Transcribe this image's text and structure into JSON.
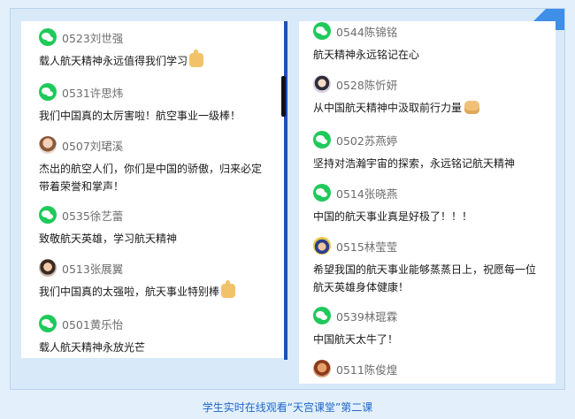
{
  "left_column": [
    {
      "user": "0523刘世强",
      "avatar": "wechat-icon",
      "text": "载人航天精神永远值得我们学习",
      "emoji": "thumbs-up-icon"
    },
    {
      "user": "0531许思炜",
      "avatar": "wechat-icon",
      "text": "我们中国真的太厉害啦！航空事业一级棒！",
      "emoji": ""
    },
    {
      "user": "0507刘珺溪",
      "avatar": "user-photo",
      "text": "杰出的航空人们，你们是中国的骄傲，归来必定带着荣誉和掌声！",
      "emoji": ""
    },
    {
      "user": "0535徐艺蕾",
      "avatar": "wechat-icon",
      "text": "致敬航天英雄，学习航天精神",
      "emoji": ""
    },
    {
      "user": "0513张展翼",
      "avatar": "user-photo",
      "text": "我们中国真的太强啦，航天事业特别棒",
      "emoji": "thumbs-up-icon"
    },
    {
      "user": "0501黄乐怡",
      "avatar": "wechat-icon",
      "text": "载人航天精神永放光芒",
      "emoji": ""
    }
  ],
  "right_column": [
    {
      "user": "0544陈锦铭",
      "avatar": "wechat-icon",
      "text": "航天精神永远铭记在心",
      "emoji": ""
    },
    {
      "user": "0528陈忻妍",
      "avatar": "user-photo",
      "text": "从中国航天精神中汲取前行力量",
      "emoji": "fist-icon"
    },
    {
      "user": "0502苏燕婷",
      "avatar": "wechat-icon",
      "text": "坚持对浩瀚宇宙的探索，永远铭记航天精神",
      "emoji": ""
    },
    {
      "user": "0514张晓燕",
      "avatar": "wechat-icon",
      "text": "中国的航天事业真是好极了！！！",
      "emoji": ""
    },
    {
      "user": "0515林莹莹",
      "avatar": "user-photo",
      "text": "希望我国的航天事业能够蒸蒸日上，祝愿每一位航天英雄身体健康！",
      "emoji": ""
    },
    {
      "user": "0539林琨霖",
      "avatar": "wechat-icon",
      "text": "中国航天太牛了！",
      "emoji": ""
    },
    {
      "user": "0511陈俊煌",
      "avatar": "user-photo",
      "text": "",
      "emoji": ""
    }
  ],
  "caption": "学生实时在线观看“天宫课堂”第二课"
}
